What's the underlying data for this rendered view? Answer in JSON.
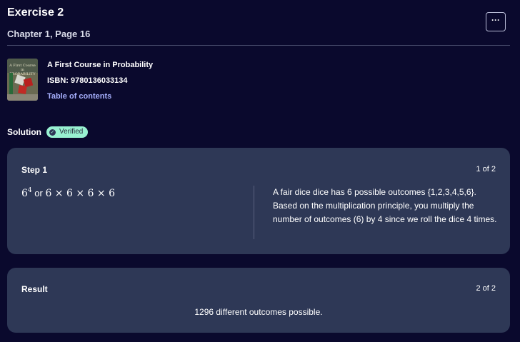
{
  "header": {
    "title": "Exercise 2",
    "subtitle": "Chapter 1, Page 16",
    "more_label": "···"
  },
  "book": {
    "cover_title": "A First Course in PROBABILITY",
    "name": "A First Course in Probability",
    "isbn": "ISBN: 9780136033134",
    "toc_label": "Table of contents"
  },
  "solution": {
    "label": "Solution",
    "badge": "Verified",
    "badge_icon": "check-circle-icon"
  },
  "step": {
    "heading": "Step 1",
    "counter": "1 of 2",
    "math_base": "6",
    "math_exponent": "4",
    "math_or": " or ",
    "math_product": "6 × 6 × 6 × 6",
    "explanation": "A fair dice dice has 6 possible outcomes {1,2,3,4,5,6}. Based on the multiplication principle, you multiply the number of outcomes (6) by 4 since we roll the dice 4 times."
  },
  "result": {
    "heading": "Result",
    "counter": "2 of 2",
    "text": "1296 different outcomes possible."
  },
  "colors": {
    "background": "#0a092d",
    "card": "#2e3856",
    "link": "#a8b1ff",
    "verified_badge": "#98f1d1"
  }
}
